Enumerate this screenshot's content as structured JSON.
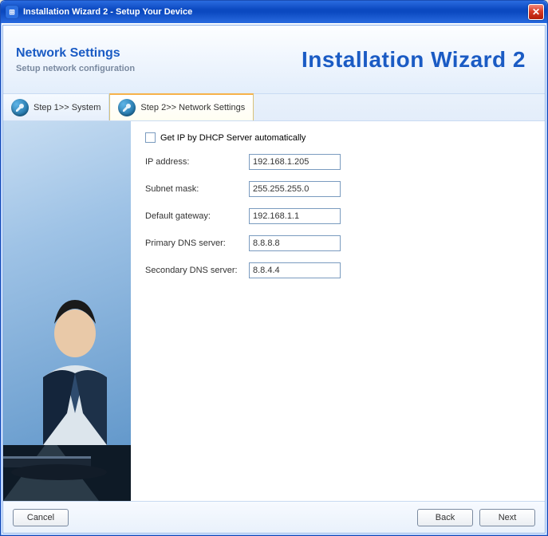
{
  "window": {
    "title": "Installation Wizard 2 - Setup Your Device"
  },
  "header": {
    "title": "Network Settings",
    "subtitle": "Setup network configuration",
    "brand": "Installation Wizard 2"
  },
  "tabs": {
    "step1": "Step 1>> System",
    "step2": "Step 2>> Network Settings"
  },
  "form": {
    "dhcp_label": "Get IP by DHCP Server automatically",
    "ip_label": "IP address:",
    "ip_value": "192.168.1.205",
    "subnet_label": "Subnet mask:",
    "subnet_value": "255.255.255.0",
    "gateway_label": "Default gateway:",
    "gateway_value": "192.168.1.1",
    "dns1_label": "Primary DNS server:",
    "dns1_value": "8.8.8.8",
    "dns2_label": "Secondary DNS server:",
    "dns2_value": "8.8.4.4"
  },
  "buttons": {
    "cancel": "Cancel",
    "back": "Back",
    "next": "Next"
  }
}
